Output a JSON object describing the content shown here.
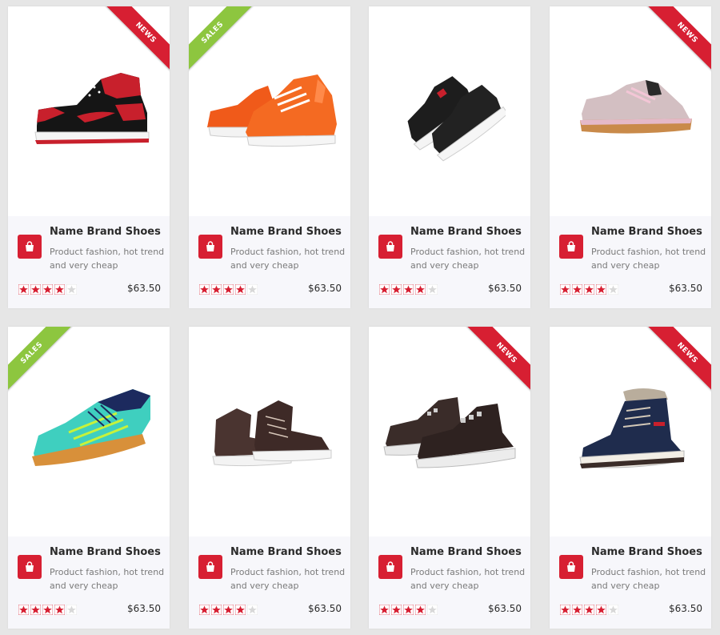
{
  "colors": {
    "bag": "#d71f32",
    "star_filled": "#d71f32",
    "star_empty": "#d8d8d8",
    "ribbon_news": "#d71f32",
    "ribbon_sales": "#8dc63f"
  },
  "products": [
    {
      "name": "Name Brand Shoes",
      "desc": "Product fashion, hot trend and very cheap",
      "price": "$63.50",
      "rating": 4,
      "rating_max": 5,
      "badge": "NEWS",
      "badge_side": "right",
      "image_icon": "red-black-high-top-sneaker-icon"
    },
    {
      "name": "Name Brand Shoes",
      "desc": "Product fashion, hot trend and very cheap",
      "price": "$63.50",
      "rating": 4,
      "rating_max": 5,
      "badge": "SALES",
      "badge_side": "left",
      "image_icon": "orange-sneaker-icon"
    },
    {
      "name": "Name Brand Shoes",
      "desc": "Product fashion, hot trend and very cheap",
      "price": "$63.50",
      "rating": 4,
      "rating_max": 5,
      "badge": "",
      "badge_side": "",
      "image_icon": "black-white-sneaker-pair-icon"
    },
    {
      "name": "Name Brand Shoes",
      "desc": "Product fashion, hot trend and very cheap",
      "price": "$63.50",
      "rating": 4,
      "rating_max": 5,
      "badge": "NEWS",
      "badge_side": "right",
      "image_icon": "pink-runner-icon"
    },
    {
      "name": "Name Brand Shoes",
      "desc": "Product fashion, hot trend and very cheap",
      "price": "$63.50",
      "rating": 4,
      "rating_max": 5,
      "badge": "SALES",
      "badge_side": "left",
      "image_icon": "teal-court-shoe-icon"
    },
    {
      "name": "Name Brand Shoes",
      "desc": "Product fashion, hot trend and very cheap",
      "price": "$63.50",
      "rating": 4,
      "rating_max": 5,
      "badge": "",
      "badge_side": "",
      "image_icon": "brown-high-top-sneaker-icon"
    },
    {
      "name": "Name Brand Shoes",
      "desc": "Product fashion, hot trend and very cheap",
      "price": "$63.50",
      "rating": 4,
      "rating_max": 5,
      "badge": "NEWS",
      "badge_side": "right",
      "image_icon": "dark-brown-sneaker-pair-icon"
    },
    {
      "name": "Name Brand Shoes",
      "desc": "Product fashion, hot trend and very cheap",
      "price": "$63.50",
      "rating": 4,
      "rating_max": 5,
      "badge": "NEWS",
      "badge_side": "right",
      "image_icon": "navy-winter-boot-icon"
    }
  ]
}
